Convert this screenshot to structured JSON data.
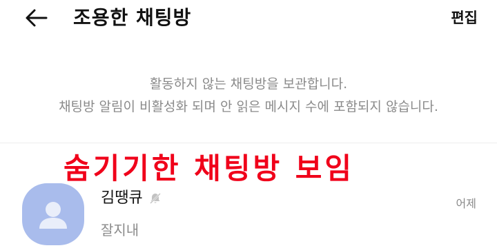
{
  "header": {
    "title": "조용한 채팅방",
    "edit_label": "편집"
  },
  "notice": {
    "line1": "활동하지 않는 채팅방을 보관합니다.",
    "line2": "채팅방 알림이 비활성화 되며 안 읽은 메시지 수에 포함되지 않습니다."
  },
  "overlay_text": "숨기기한 채팅방 보임",
  "chats": [
    {
      "name": "김땡큐",
      "preview": "잘지내",
      "time": "어제",
      "muted": true,
      "avatar_color": "#a9bcec"
    }
  ],
  "colors": {
    "overlay_red": "#f0001a",
    "muted_text": "#8a8a8a",
    "avatar": "#a9bcec"
  },
  "icons": {
    "back": "back-arrow-icon",
    "mute": "bell-off-icon",
    "avatar": "default-person-icon"
  }
}
